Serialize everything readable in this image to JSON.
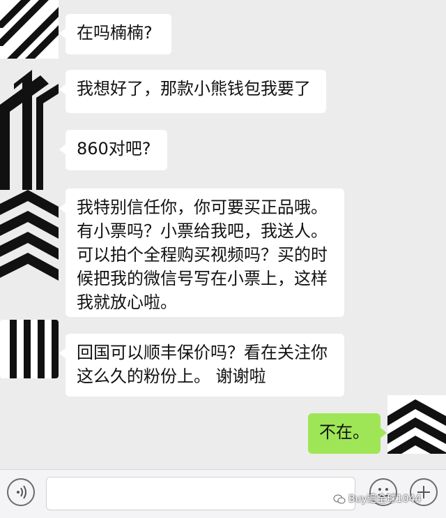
{
  "messages": [
    {
      "side": "in",
      "text": "在吗楠楠?"
    },
    {
      "side": "in",
      "text": "我想好了，那款小熊钱包我要了"
    },
    {
      "side": "in",
      "text": "860对吧?"
    },
    {
      "side": "in",
      "text": "我特别信任你，你可要买正品哦。有小票吗？小票给我吧，我送人。可以拍个全程购买视频吗？买的时候把我的微信号写在小票上，这样我就放心啦。"
    },
    {
      "side": "in",
      "text": "回国可以顺丰保价吗？看在关注你这么久的粉份上。 谢谢啦"
    },
    {
      "side": "out",
      "text": "不在。"
    }
  ],
  "input": {
    "value": ""
  },
  "icons": {
    "voice": "voice-icon",
    "emoji": "emoji-icon",
    "more": "plus-icon"
  },
  "watermark": "Buy遍全球1044",
  "colors": {
    "background": "#ececec",
    "bubble_in": "#ffffff",
    "bubble_out": "#9fe657"
  }
}
